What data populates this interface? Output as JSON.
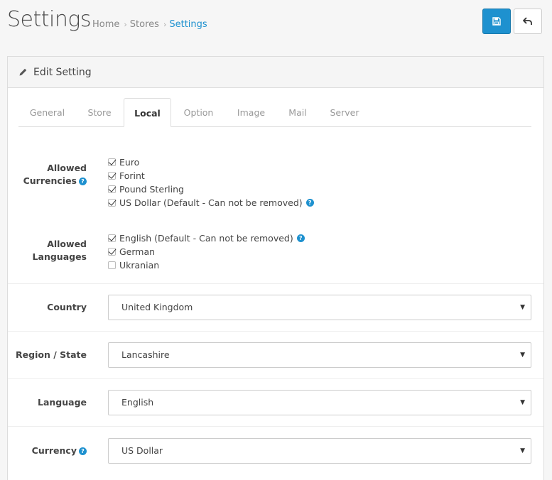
{
  "header": {
    "title": "Settings",
    "breadcrumb": [
      {
        "label": "Home"
      },
      {
        "label": "Stores"
      },
      {
        "label": "Settings"
      }
    ],
    "save_icon": "save-icon",
    "back_icon": "reply-icon",
    "accent_color": "#1e91cf"
  },
  "panel": {
    "heading": "Edit Setting",
    "heading_icon": "pencil-icon"
  },
  "tabs": [
    {
      "label": "General"
    },
    {
      "label": "Store"
    },
    {
      "label": "Local",
      "active": true
    },
    {
      "label": "Option"
    },
    {
      "label": "Image"
    },
    {
      "label": "Mail"
    },
    {
      "label": "Server"
    }
  ],
  "form": {
    "currencies": {
      "label_line1": "Allowed",
      "label_line2": "Currencies",
      "options": [
        {
          "label": "Euro",
          "checked": true
        },
        {
          "label": "Forint",
          "checked": true
        },
        {
          "label": "Pound Sterling",
          "checked": true
        },
        {
          "label": "US Dollar (Default - Can not be removed)",
          "checked": true
        }
      ]
    },
    "languages": {
      "label_line1": "Allowed",
      "label_line2": "Languages",
      "options": [
        {
          "label": "English (Default - Can not be removed)",
          "checked": true
        },
        {
          "label": "German",
          "checked": true
        },
        {
          "label": "Ukranian",
          "checked": false
        }
      ]
    },
    "country": {
      "label": "Country",
      "value": "United Kingdom"
    },
    "region": {
      "label": "Region / State",
      "value": "Lancashire"
    },
    "language": {
      "label": "Language",
      "value": "English"
    },
    "currency": {
      "label": "Currency",
      "value": "US Dollar"
    }
  }
}
